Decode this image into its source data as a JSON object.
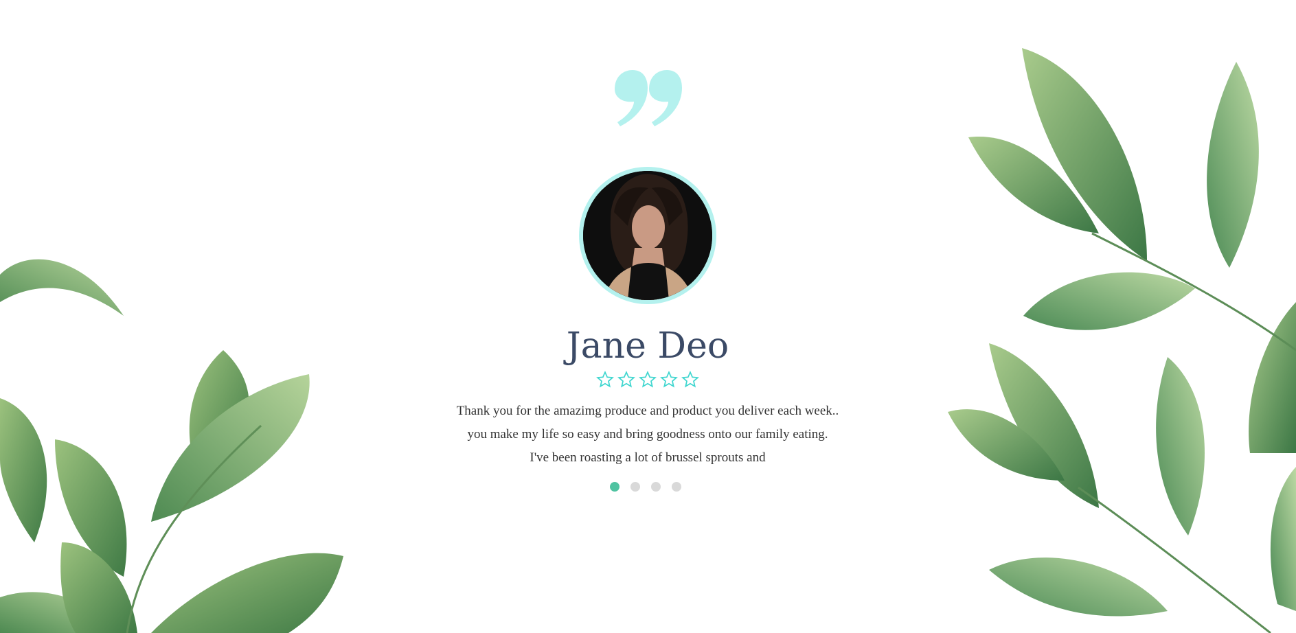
{
  "testimonial": {
    "name": "Jane Deo",
    "rating": 5,
    "message_lines": [
      "Thank you for the amazimg produce and product you deliver each week..",
      "you make my life so easy and bring goodness onto our family eating.",
      "I've been roasting a lot of brussel sprouts and"
    ],
    "avatar_icon": "woman-portrait-photo",
    "quote_icon": "quote-mark-icon"
  },
  "carousel": {
    "slides": 4,
    "active_index": 0
  },
  "colors": {
    "accent": "#b4f1ee",
    "star_outline": "#3fd6cf",
    "name_text": "#3b4a66",
    "dot_active": "#4fc3a1",
    "dot_inactive": "#d9d9d9"
  }
}
